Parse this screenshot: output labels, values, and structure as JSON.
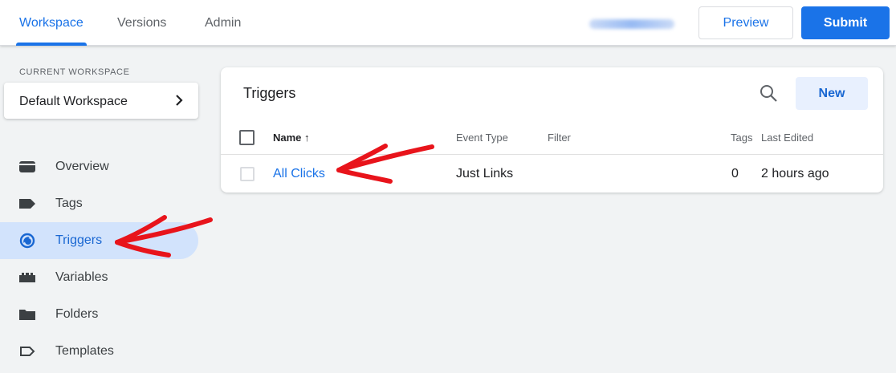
{
  "header": {
    "tabs": [
      {
        "label": "Workspace",
        "active": true
      },
      {
        "label": "Versions",
        "active": false
      },
      {
        "label": "Admin",
        "active": false
      }
    ],
    "preview_label": "Preview",
    "submit_label": "Submit"
  },
  "sidebar": {
    "workspace_caption": "CURRENT WORKSPACE",
    "workspace_name": "Default Workspace",
    "items": [
      {
        "label": "Overview",
        "icon": "overview-icon",
        "active": false
      },
      {
        "label": "Tags",
        "icon": "tag-icon",
        "active": false
      },
      {
        "label": "Triggers",
        "icon": "trigger-icon",
        "active": true
      },
      {
        "label": "Variables",
        "icon": "variables-icon",
        "active": false
      },
      {
        "label": "Folders",
        "icon": "folder-icon",
        "active": false
      },
      {
        "label": "Templates",
        "icon": "templates-icon",
        "active": false
      }
    ]
  },
  "main": {
    "title": "Triggers",
    "new_label": "New",
    "columns": [
      "Name",
      "Event Type",
      "Filter",
      "Tags",
      "Last Edited"
    ],
    "sort_indicator": "↑",
    "rows": [
      {
        "name": "All Clicks",
        "event_type": "Just Links",
        "filter": "",
        "tags": "0",
        "last_edited": "2 hours ago"
      }
    ]
  },
  "colors": {
    "accent": "#1a73e8",
    "active_nav_bg": "#d2e3fc",
    "annotation": "#e8141b"
  }
}
